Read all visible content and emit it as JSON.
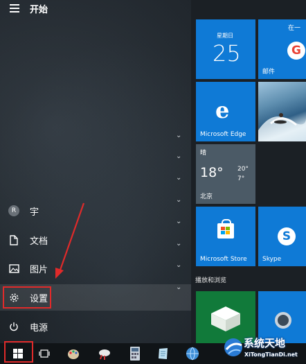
{
  "header": {
    "title": "开始"
  },
  "rail": {
    "user": {
      "avatar_letter": "R",
      "label": "宇"
    },
    "documents": {
      "label": "文档"
    },
    "pictures": {
      "label": "图片"
    },
    "settings": {
      "label": "设置"
    },
    "power": {
      "label": "电源"
    }
  },
  "tiles": {
    "calendar": {
      "weekday": "星期日",
      "day": "25"
    },
    "mail": {
      "top_text": "在一",
      "label": "邮件"
    },
    "edge": {
      "label": "Microsoft Edge"
    },
    "weather": {
      "condition": "晴",
      "temp": "18°",
      "high": "20°",
      "low": "7°",
      "city": "北京"
    },
    "store": {
      "label": "Microsoft Store"
    },
    "skype": {
      "label": "Skype"
    }
  },
  "section": {
    "label": "播放和浏览"
  },
  "watermark": {
    "title": "系统天地",
    "url": "XiTongTianDi.net"
  },
  "colors": {
    "accent": "#0f7ad6",
    "highlight": "#e02a2a"
  }
}
